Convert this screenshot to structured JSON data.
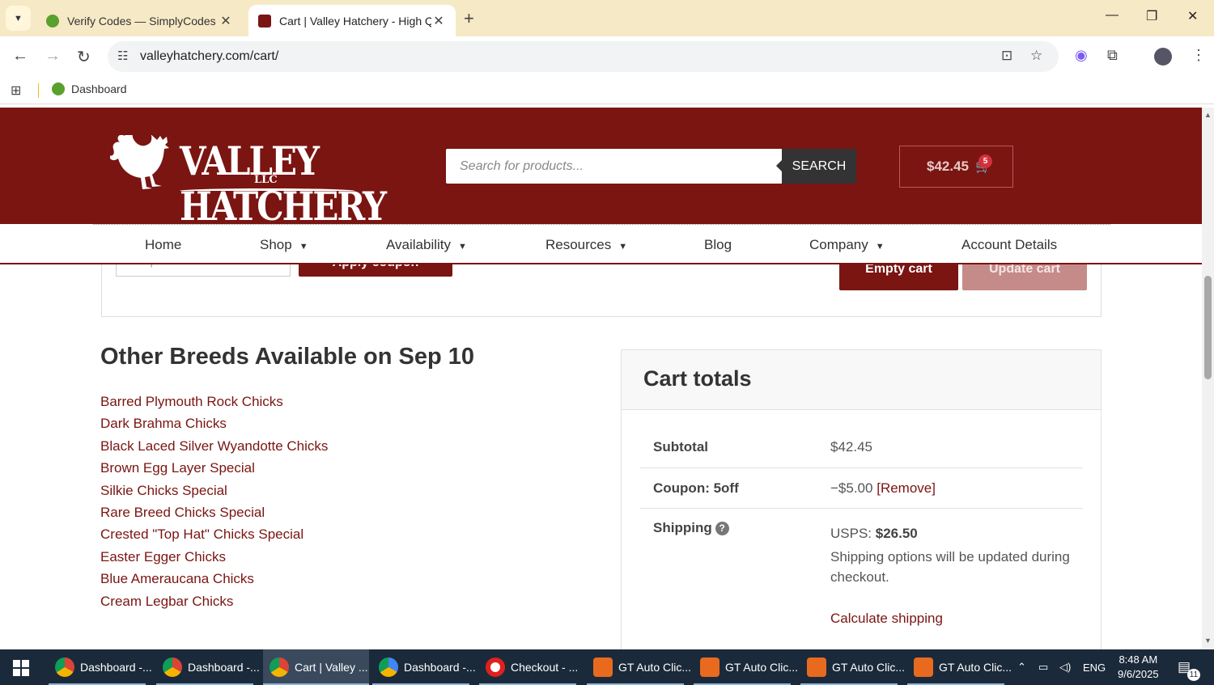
{
  "browser": {
    "tabs": [
      {
        "title": "Verify Codes — SimplyCodes",
        "active": false,
        "favicon_color": "#5aa02c"
      },
      {
        "title": "Cart | Valley Hatchery - High Qu",
        "active": true,
        "favicon_color": "#7a1512"
      }
    ],
    "url": "valleyhatchery.com/cart/",
    "bookmarks": [
      {
        "label": "Dashboard"
      }
    ]
  },
  "site": {
    "brand_color": "#7a1512",
    "logo": {
      "text": "VALLEY HATCHERY",
      "sub": "LLC"
    },
    "search": {
      "placeholder": "Search for products...",
      "button": "SEARCH"
    },
    "cart": {
      "total": "$42.45",
      "count": "5"
    },
    "nav": [
      {
        "label": "Home",
        "dropdown": false
      },
      {
        "label": "Shop",
        "dropdown": true
      },
      {
        "label": "Availability",
        "dropdown": true
      },
      {
        "label": "Resources",
        "dropdown": true
      },
      {
        "label": "Blog",
        "dropdown": false
      },
      {
        "label": "Company",
        "dropdown": true
      },
      {
        "label": "Account Details",
        "dropdown": false
      }
    ]
  },
  "cart_actions": {
    "coupon_placeholder": "Coupon code",
    "apply_coupon": "Apply coupon",
    "empty_cart": "Empty cart",
    "update_cart": "Update cart"
  },
  "other_breeds": {
    "title": "Other Breeds Available on Sep 10",
    "items": [
      "Barred Plymouth Rock Chicks",
      "Dark Brahma Chicks",
      "Black Laced Silver Wyandotte Chicks",
      "Brown Egg Layer Special",
      "Silkie Chicks Special",
      "Rare Breed Chicks Special",
      "Crested \"Top Hat\" Chicks Special",
      "Easter Egger Chicks",
      "Blue Ameraucana Chicks",
      "Cream Legbar Chicks"
    ]
  },
  "cart_totals": {
    "title": "Cart totals",
    "subtotal_label": "Subtotal",
    "subtotal_value": "$42.45",
    "coupon_label": "Coupon: 5off",
    "coupon_value": "−$5.00",
    "coupon_remove": "[Remove]",
    "shipping_label": "Shipping",
    "shipping_method": "USPS:",
    "shipping_price": "$26.50",
    "shipping_note": "Shipping options will be updated during checkout.",
    "calculate_shipping": "Calculate shipping"
  },
  "taskbar": {
    "apps": [
      {
        "label": "Dashboard -...",
        "icon": "chrome-icon"
      },
      {
        "label": "Dashboard -...",
        "icon": "chrome-icon"
      },
      {
        "label": "Cart | Valley ...",
        "icon": "chrome-icon",
        "active": true
      },
      {
        "label": "Dashboard -...",
        "icon": "chrome-icon"
      },
      {
        "label": "Checkout - ...",
        "icon": "opera-icon"
      },
      {
        "label": "GT Auto Clic...",
        "icon": "hand-icon"
      },
      {
        "label": "GT Auto Clic...",
        "icon": "hand-icon"
      },
      {
        "label": "GT Auto Clic...",
        "icon": "hand-icon"
      },
      {
        "label": "GT Auto Clic...",
        "icon": "hand-icon"
      }
    ],
    "language": "ENG",
    "time": "8:48 AM",
    "date": "9/6/2025",
    "notifications": "11"
  }
}
